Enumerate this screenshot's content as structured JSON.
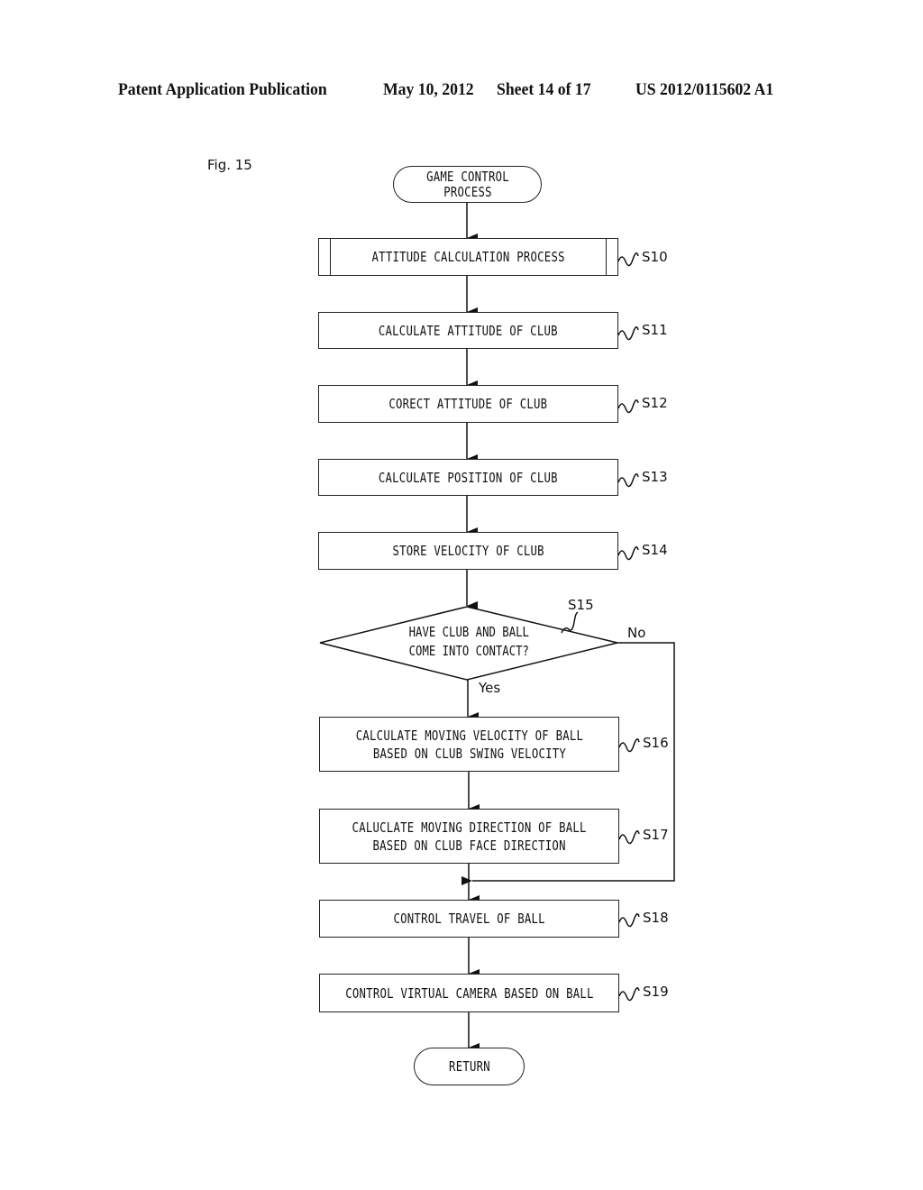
{
  "header": {
    "publication": "Patent Application Publication",
    "date": "May 10, 2012",
    "sheet": "Sheet 14 of 17",
    "number": "US 2012/0115602 A1"
  },
  "figure": {
    "label": "Fig. 15",
    "start": "GAME CONTROL\nPROCESS",
    "end": "RETURN",
    "steps": [
      {
        "id": "S10",
        "text": "ATTITUDE CALCULATION PROCESS",
        "kind": "subroutine"
      },
      {
        "id": "S11",
        "text": "CALCULATE ATTITUDE OF CLUB",
        "kind": "process"
      },
      {
        "id": "S12",
        "text": "CORECT ATTITUDE OF CLUB",
        "kind": "process"
      },
      {
        "id": "S13",
        "text": "CALCULATE POSITION OF CLUB",
        "kind": "process"
      },
      {
        "id": "S14",
        "text": "STORE VELOCITY OF CLUB",
        "kind": "process"
      },
      {
        "id": "S15",
        "text": "HAVE CLUB AND BALL\nCOME INTO CONTACT?",
        "kind": "decision",
        "yes": "Yes",
        "no": "No"
      },
      {
        "id": "S16",
        "text": "CALCULATE MOVING VELOCITY OF BALL\nBASED ON CLUB SWING VELOCITY",
        "kind": "process"
      },
      {
        "id": "S17",
        "text": "CALUCLATE MOVING DIRECTION OF BALL\nBASED ON CLUB FACE DIRECTION",
        "kind": "process"
      },
      {
        "id": "S18",
        "text": "CONTROL TRAVEL OF BALL",
        "kind": "process"
      },
      {
        "id": "S19",
        "text": "CONTROL VIRTUAL CAMERA BASED ON BALL",
        "kind": "process"
      }
    ]
  }
}
